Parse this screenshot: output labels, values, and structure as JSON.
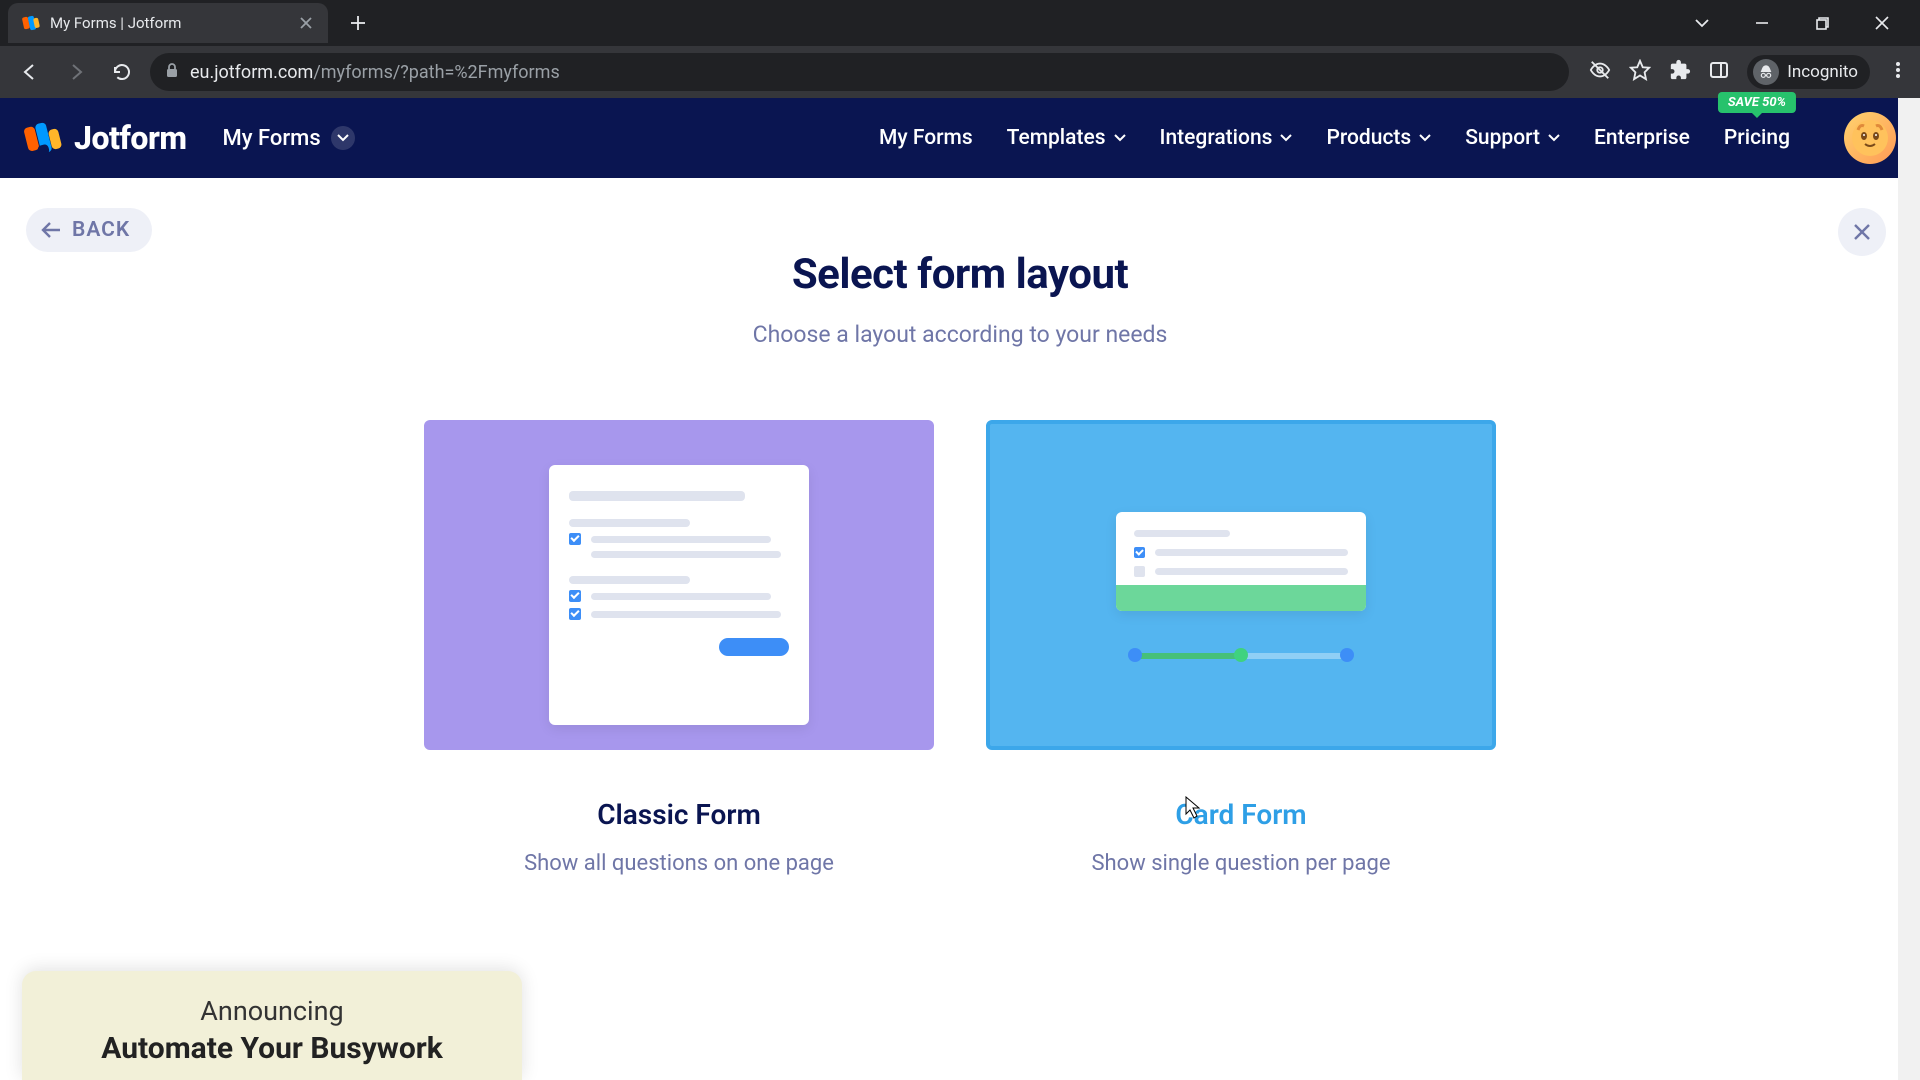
{
  "browser": {
    "tab_title": "My Forms | Jotform",
    "address_host": "eu.jotform.com",
    "address_path": "/myforms/?path=%2Fmyforms",
    "incognito_label": "Incognito"
  },
  "header": {
    "brand": "Jotform",
    "breadcrumb": "My Forms",
    "nav": {
      "my_forms": "My Forms",
      "templates": "Templates",
      "integrations": "Integrations",
      "products": "Products",
      "support": "Support",
      "enterprise": "Enterprise",
      "pricing": "Pricing"
    },
    "save_badge": "SAVE 50%"
  },
  "page": {
    "back_label": "BACK",
    "title": "Select form layout",
    "subtitle": "Choose a layout according to your needs",
    "classic": {
      "title": "Classic Form",
      "desc": "Show all questions on one page"
    },
    "cardform": {
      "title": "Card Form",
      "desc": "Show single question per page"
    },
    "popup_line1": "Announcing",
    "popup_line2": "Automate Your Busywork"
  }
}
